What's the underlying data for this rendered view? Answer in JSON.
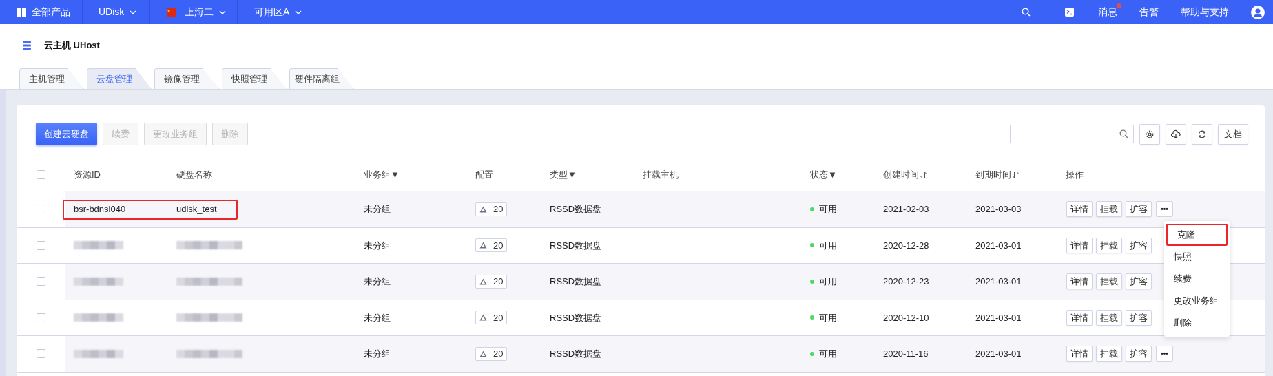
{
  "top_bar": {
    "products": "全部产品",
    "product": "UDisk",
    "region": "上海二",
    "zone": "可用区A",
    "links": [
      {
        "label": "消息",
        "badge": true
      },
      {
        "label": "告警",
        "badge": false
      },
      {
        "label": "帮助与支持",
        "badge": false
      }
    ]
  },
  "header": {
    "title": "云主机 UHost"
  },
  "tabs": [
    {
      "label": "主机管理",
      "selected": false
    },
    {
      "label": "云盘管理",
      "selected": true
    },
    {
      "label": "镜像管理",
      "selected": false
    },
    {
      "label": "快照管理",
      "selected": false
    },
    {
      "label": "硬件隔离组",
      "selected": false
    }
  ],
  "toolbar": {
    "buttons": [
      {
        "label": "创建云硬盘",
        "kind": "primary",
        "disabled": false
      },
      {
        "label": "续费",
        "kind": "plain",
        "disabled": true
      },
      {
        "label": "更改业务组",
        "kind": "plain",
        "disabled": true
      },
      {
        "label": "删除",
        "kind": "plain",
        "disabled": true
      }
    ],
    "docs": "文档"
  },
  "table": {
    "all_checked": false,
    "columns": [
      {
        "label": "资源ID",
        "sortable": false
      },
      {
        "label": "硬盘名称",
        "sortable": false
      },
      {
        "label": "业务组▼",
        "sortable": false
      },
      {
        "label": "配置",
        "sortable": false
      },
      {
        "label": "类型▼",
        "sortable": false
      },
      {
        "label": "挂载主机",
        "sortable": false
      },
      {
        "label": "状态▼",
        "sortable": false
      },
      {
        "label": "创建时间",
        "sortable": true
      },
      {
        "label": "到期时间",
        "sortable": true
      },
      {
        "label": "操作",
        "sortable": false
      }
    ],
    "rows": [
      {
        "highlighted": true,
        "id": "bsr-bdnsi040",
        "name": "udisk_test",
        "group": "未分组",
        "size": "20",
        "type": "RSSD数据盘",
        "status": "可用",
        "color": "#4cd964",
        "created": "2021-02-03",
        "expires": "2021-03-03",
        "actions": [
          "详情",
          "挂载",
          "扩容"
        ],
        "more": "•••",
        "checked": false
      },
      {
        "highlighted": false,
        "group": "未分组",
        "size": "20",
        "type": "RSSD数据盘",
        "status": "可用",
        "color": "#4cd964",
        "created": "2020-12-28",
        "expires": "2021-03-01",
        "actions": [
          "详情",
          "挂载",
          "扩容"
        ],
        "checked": false
      },
      {
        "highlighted": false,
        "group": "未分组",
        "size": "20",
        "type": "RSSD数据盘",
        "status": "可用",
        "color": "#4cd964",
        "created": "2020-12-23",
        "expires": "2021-03-01",
        "actions": [
          "详情",
          "挂载",
          "扩容"
        ],
        "checked": false
      },
      {
        "highlighted": false,
        "group": "未分组",
        "size": "20",
        "type": "RSSD数据盘",
        "status": "可用",
        "color": "#4cd964",
        "created": "2020-12-10",
        "expires": "2021-03-01",
        "actions": [
          "详情",
          "挂载",
          "扩容"
        ],
        "checked": false
      },
      {
        "highlighted": false,
        "group": "未分组",
        "size": "20",
        "type": "RSSD数据盘",
        "status": "可用",
        "color": "#4cd964",
        "created": "2020-11-16",
        "expires": "2021-03-01",
        "actions": [
          "详情",
          "挂载",
          "扩容"
        ],
        "more": "•••",
        "checked": false
      }
    ]
  },
  "dropdown_menu": {
    "items": [
      {
        "label": "克隆",
        "highlighted": true
      },
      {
        "label": "快照",
        "highlighted": false
      },
      {
        "label": "续费",
        "highlighted": false
      },
      {
        "label": "更改业务组",
        "highlighted": false
      },
      {
        "label": "删除",
        "highlighted": false
      }
    ]
  }
}
